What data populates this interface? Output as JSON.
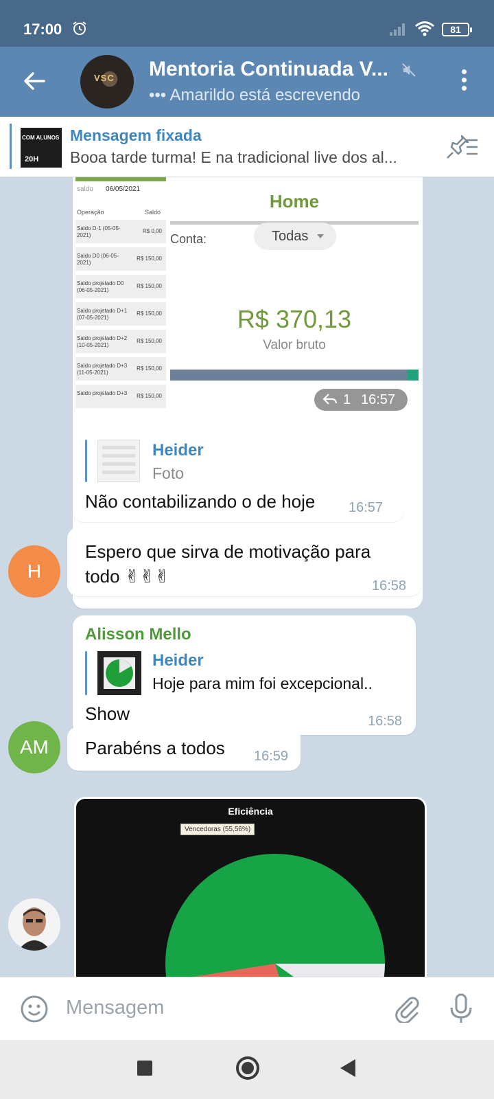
{
  "status_bar": {
    "time": "17:00",
    "battery": "81"
  },
  "header": {
    "title": "Mentoria Continuada V...",
    "subtitle": "••• Amarildo está escrevendo",
    "avatar_logo": "VSC"
  },
  "pinned": {
    "title": "Mensagem fixada",
    "text": "Booa tarde turma!  E na tradicional live dos al...",
    "thumb_line1": "COM ALUNOS",
    "thumb_line2": "20H"
  },
  "messages": {
    "image1": {
      "left_screen": {
        "date_label": "saldo",
        "date": "06/05/2021",
        "col_op": "Operação",
        "col_saldo": "Saldo",
        "rows": [
          {
            "label": "Saldo D-1 (05-05-2021)",
            "value": "R$ 0,00"
          },
          {
            "label": "Saldo D0 (06-05-2021)",
            "value": "R$ 150,00"
          },
          {
            "label": "Saldo projetado D0 (06-05-2021)",
            "value": "R$ 150,00"
          },
          {
            "label": "Saldo projetado D+1 (07-05-2021)",
            "value": "R$ 150,00"
          },
          {
            "label": "Saldo projetado D+2 (10-05-2021)",
            "value": "R$ 150,00"
          },
          {
            "label": "Saldo projetado D+3 (11-05-2021)",
            "value": "R$ 150,00"
          },
          {
            "label": "Saldo projetado D+3",
            "value": "R$ 150,00"
          }
        ]
      },
      "right_screen": {
        "title": "Home",
        "account_label": "Conta:",
        "account_value": "Todas",
        "amount": "R$ 370,13",
        "amount_label": "Valor bruto"
      },
      "replies": "1",
      "time": "16:57"
    },
    "reply1": {
      "quote_name": "Heider",
      "quote_sub": "Foto",
      "text": "Não contabilizando o de hoje",
      "time": "16:57"
    },
    "msg_h": {
      "avatar": "H",
      "text_line1": "Espero que sirva de motivação para",
      "text_line2": "todo ✌✌✌",
      "time": "16:58"
    },
    "msg_alisson": {
      "sender": "Alisson Mello",
      "quote_name": "Heider",
      "quote_sub": "Hoje para mim foi excepcional..",
      "text": "Show",
      "time": "16:58"
    },
    "msg_am": {
      "avatar": "AM",
      "text": "Parabéns a todos",
      "time": "16:59"
    },
    "chart_image": {
      "title": "Eficiência",
      "tooltip": "Vencedoras (55,56%)"
    }
  },
  "input": {
    "placeholder": "Mensagem"
  },
  "colors": {
    "header": "#5c87b2",
    "status_bar": "#49698a",
    "avatar_h": "#f28c48",
    "avatar_am": "#6fb54a",
    "link_blue": "#3f87c1",
    "sender_green": "#4f9a3a"
  }
}
